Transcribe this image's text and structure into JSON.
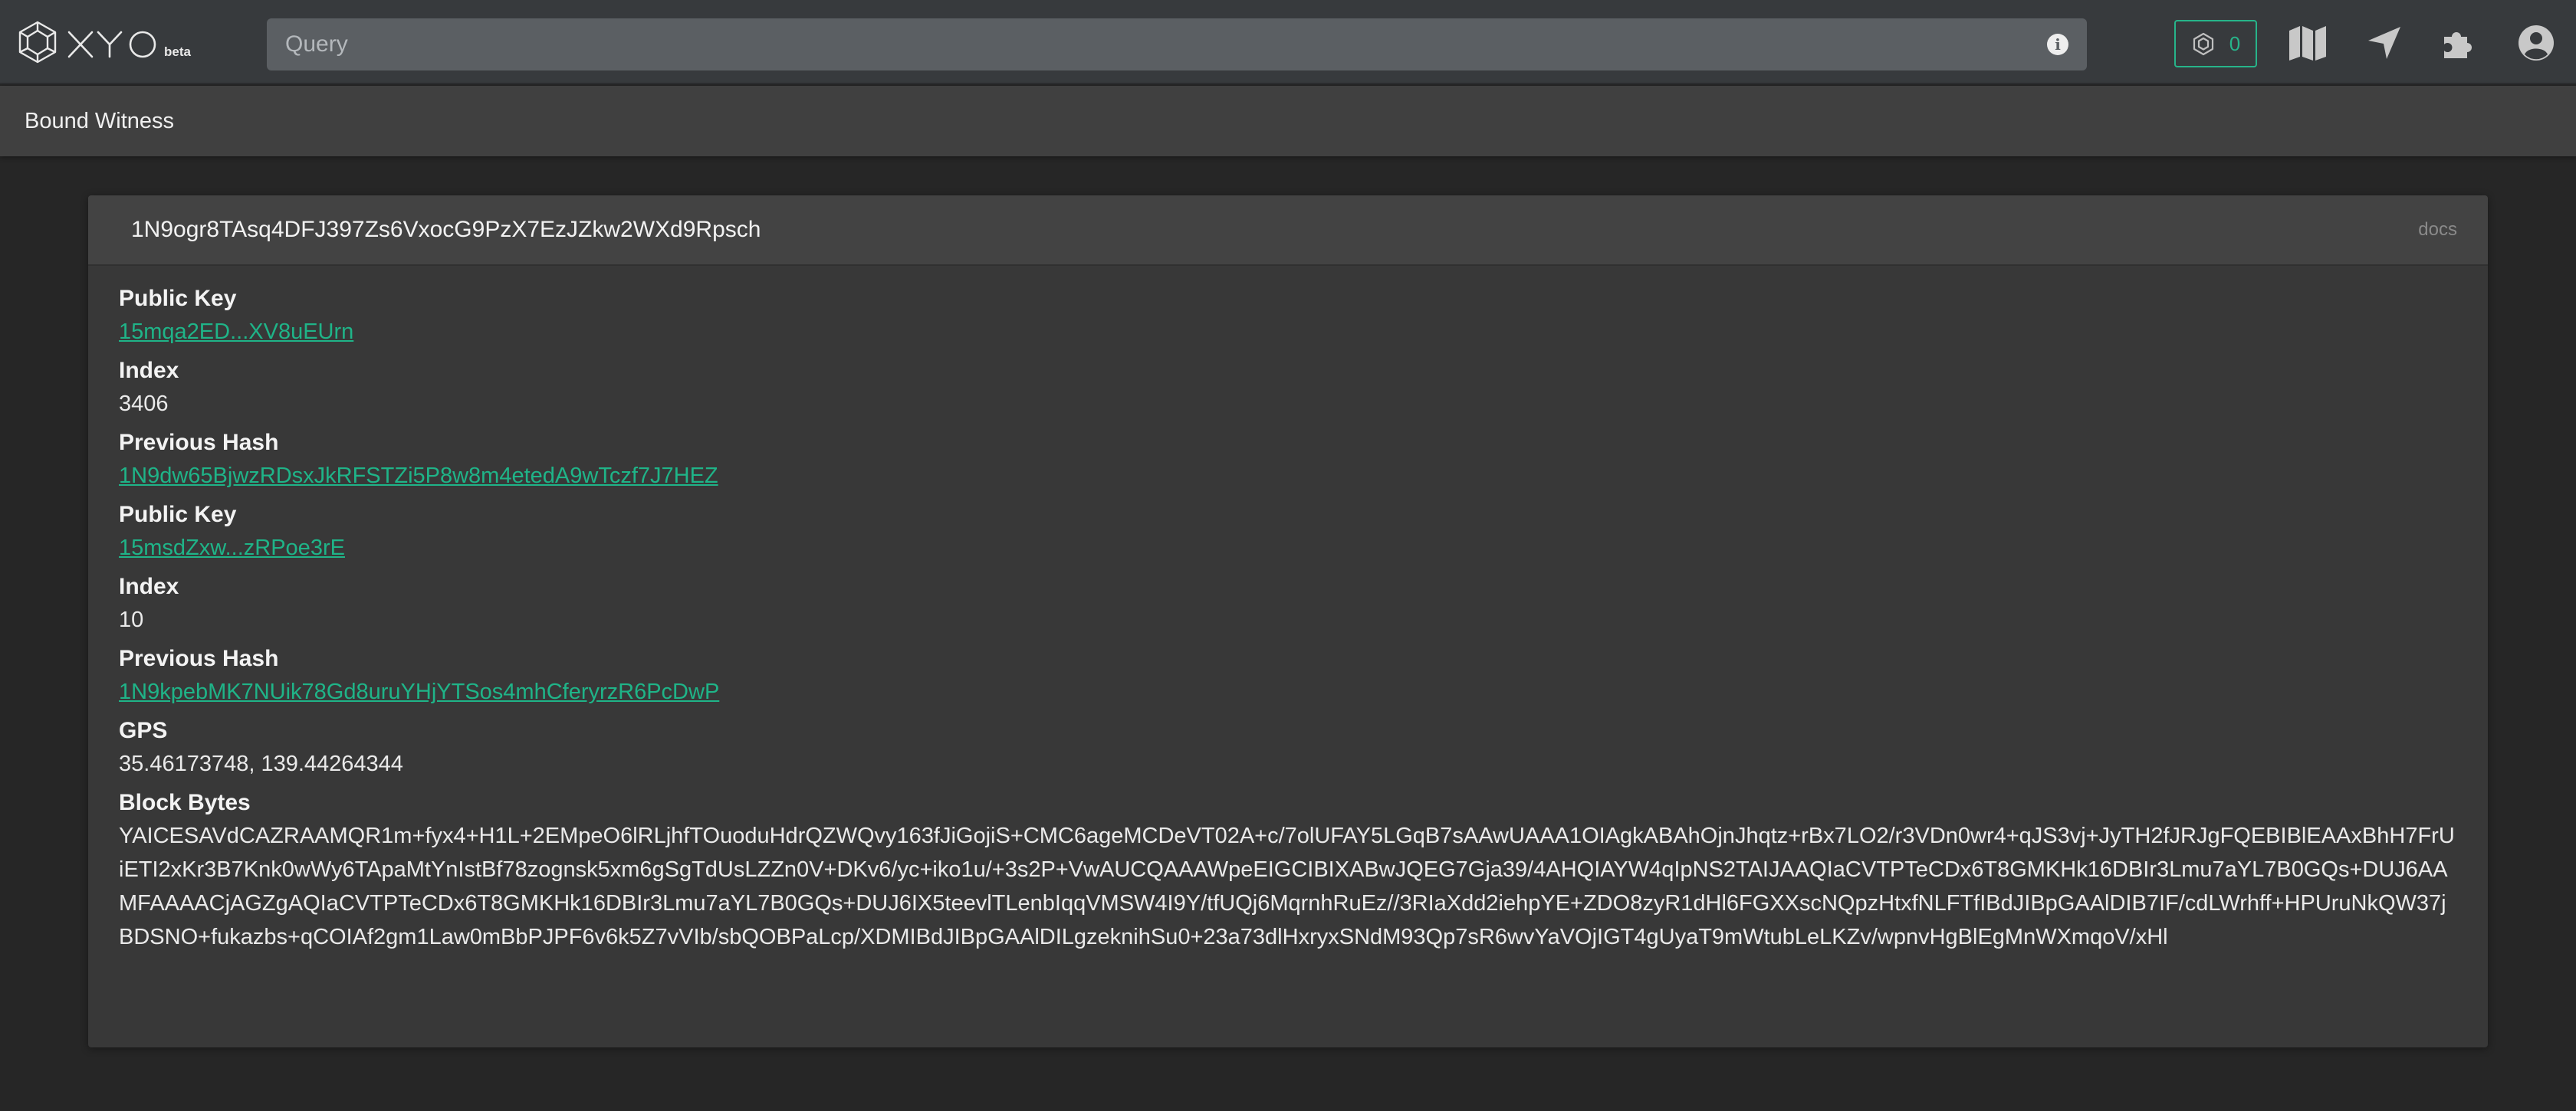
{
  "header": {
    "brand": "XYO",
    "beta_label": "beta",
    "search_placeholder": "Query",
    "peer_count": "0",
    "icons": [
      "network-icon",
      "map-icon",
      "location-arrow-icon",
      "puzzle-icon",
      "user-icon",
      "info-icon"
    ],
    "accent_color": "#27b48a"
  },
  "subheader": {
    "title": "Bound Witness"
  },
  "card": {
    "hash": "1N9ogr8TAsq4DFJ397Zs6VxocG9PzX7EzJZkw2WXd9Rpsch",
    "docs_label": "docs",
    "fields": [
      {
        "label": "Public Key",
        "value": "15mqa2ED...XV8uEUrn"
      },
      {
        "label": "Index",
        "value": "3406"
      },
      {
        "label": "Previous Hash",
        "value": "1N9dw65BjwzRDsxJkRFSTZi5P8w8m4etedA9wTczf7J7HEZ"
      },
      {
        "label": "Public Key",
        "value": "15msdZxw...zRPoe3rE"
      },
      {
        "label": "Index",
        "value": "10"
      },
      {
        "label": "Previous Hash",
        "value": "1N9kpebMK7NUik78Gd8uruYHjYTSos4mhCferyrzR6PcDwP"
      },
      {
        "label": "GPS",
        "value": "35.46173748, 139.44264344"
      },
      {
        "label": "Block Bytes",
        "value": "YAICESAVdCAZRAAMQR1m+fyx4+H1L+2EMpeO6lRLjhfTOuoduHdrQZWQvy163fJiGojiS+CMC6ageMCDeVT02A+c/7olUFAY5LGqB7sAAwUAAA1OIAgkABAhOjnJhqtz+rBx7LO2/r3VDn0wr4+qJS3vj+JyTH2fJRJgFQEBIBlEAAxBhH7FrUiETI2xKr3B7Knk0wWy6TApaMtYnIstBf78zognsk5xm6gSgTdUsLZZn0V+DKv6/yc+iko1u/+3s2P+VwAUCQAAAWpeEIGCIBIXABwJQEG7Gja39/4AHQIAYW4qIpNS2TAIJAAQIaCVTPTeCDx6T8GMKHk16DBIr3Lmu7aYL7B0GQs+DUJ6AAMFAAAACjAGZgAQIaCVTPTeCDx6T8GMKHk16DBIr3Lmu7aYL7B0GQs+DUJ6IX5teevlTLenbIqqVMSW4I9Y/tfUQj6MqrnhRuEz//3RIaXdd2iehpYE+ZDO8zyR1dHl6FGXXscNQpzHtxfNLFTfIBdJIBpGAAlDIB7IF/cdLWrhff+HPUruNkQW37jBDSNO+fukazbs+qCOIAf2gm1Law0mBbPJPF6v6k5Z7vVIb/sbQOBPaLcp/XDMIBdJIBpGAAlDILgzeknihSu0+23a73dlHxryxSNdM93Qp7sR6wvYaVOjIGT4gUyaT9mWtubLeLKZv/wpnvHgBlEgMnWXmqoV/xHl"
      }
    ]
  }
}
